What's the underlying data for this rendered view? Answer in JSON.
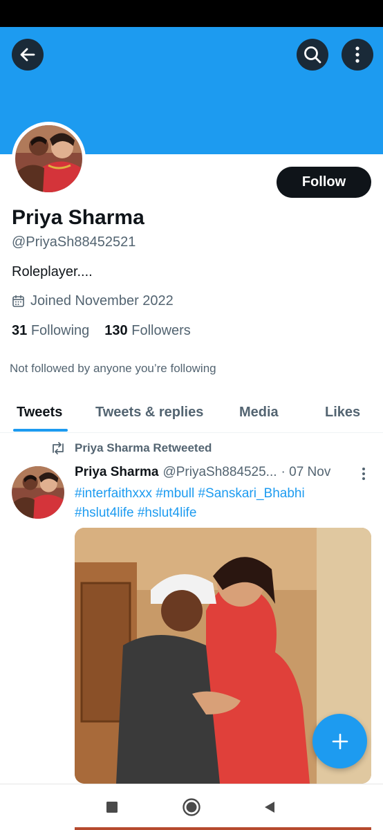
{
  "header": {
    "back_icon": "arrow-left-icon",
    "search_icon": "search-icon",
    "more_icon": "more-vertical-icon",
    "banner_color": "#1d9bf0"
  },
  "profile": {
    "follow_label": "Follow",
    "name": "Priya Sharma",
    "handle": "@PriyaSh88452521",
    "bio": "Roleplayer....",
    "joined": "Joined November 2022",
    "following_count": "31",
    "following_label": "Following",
    "followers_count": "130",
    "followers_label": "Followers",
    "not_followed_note": "Not followed by anyone you’re following"
  },
  "tabs": [
    {
      "label": "Tweets",
      "active": true
    },
    {
      "label": "Tweets & replies",
      "active": false
    },
    {
      "label": "Media",
      "active": false
    },
    {
      "label": "Likes",
      "active": false
    }
  ],
  "tweet": {
    "retweet_label": "Priya Sharma Retweeted",
    "author_name": "Priya Sharma",
    "author_handle": "@PriyaSh884525...",
    "date": "· 07 Nov",
    "hashtags_line1": "#interfaithxxx #mbull #Sanskari_Bhabhi",
    "hashtags_line2": "#hslut4life #hslut4life"
  },
  "colors": {
    "accent": "#1d9bf0",
    "text_primary": "#0f1419",
    "text_secondary": "#536471",
    "follow_button": "#0f1419"
  }
}
